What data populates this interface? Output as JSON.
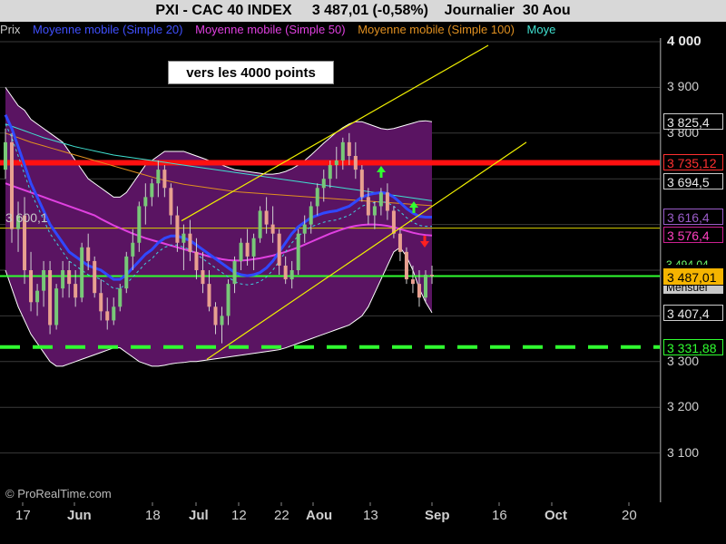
{
  "header": {
    "symbol": "PXI - CAC 40 INDEX",
    "quote": "3 487,01 (-0,58%)",
    "period": "Journalier  30 Aou"
  },
  "legend": [
    {
      "label": "Prix",
      "color": "#c8c8c8"
    },
    {
      "label": "Moyenne mobile (Simple 20)",
      "color": "#3048ff"
    },
    {
      "label": "Moyenne mobile (Simple 50)",
      "color": "#e040e0"
    },
    {
      "label": "Moyenne mobile (Simple 100)",
      "color": "#e09020"
    },
    {
      "label": "Moye",
      "color": "#40e0d0"
    }
  ],
  "annotation": "vers les 4000 points",
  "inline_label": "3 600,1",
  "copyright": "© ProRealTime.com",
  "chart_data": {
    "type": "line",
    "title": "PXI - CAC 40 INDEX",
    "ylim": [
      3020,
      4060
    ],
    "y_ticks": [
      "4 000",
      "3 900",
      "3 800",
      "3 300",
      "3 200",
      "3 100"
    ],
    "x_ticks": [
      {
        "label": "17",
        "bold": false
      },
      {
        "label": "Jun",
        "bold": true
      },
      {
        "label": "18",
        "bold": false
      },
      {
        "label": "Jul",
        "bold": true
      },
      {
        "label": "12",
        "bold": false
      },
      {
        "label": "22",
        "bold": false
      },
      {
        "label": "Aou",
        "bold": true
      },
      {
        "label": "13",
        "bold": false
      },
      {
        "label": "Sep",
        "bold": true
      },
      {
        "label": "16",
        "bold": false
      },
      {
        "label": "Oct",
        "bold": true
      },
      {
        "label": "20",
        "bold": false
      }
    ],
    "price_tags": [
      {
        "value": "3 825,4",
        "bg": "#000000",
        "fg": "#e8e8e8",
        "border": "#cccccc"
      },
      {
        "value": "3 735,12",
        "bg": "#000000",
        "fg": "#ff3030",
        "border": "#ff3030"
      },
      {
        "value": "3 694,5",
        "bg": "#000000",
        "fg": "#e8e8e8",
        "border": "#cccccc"
      },
      {
        "value": "3 616,4",
        "bg": "#000000",
        "fg": "#9a5cc8",
        "border": "#9a5cc8"
      },
      {
        "value": "3 576,4",
        "bg": "#000000",
        "fg": "#ff40c0",
        "border": "#cc2090"
      },
      {
        "value": "3 487,01",
        "bg": "#f5b400",
        "fg": "#000000",
        "border": "#f5b400"
      },
      {
        "value": "3 407,4",
        "bg": "#000000",
        "fg": "#e8e8e8",
        "border": "#cccccc"
      },
      {
        "value": "3 331,88",
        "bg": "#000000",
        "fg": "#30ff30",
        "border": "#30ff30"
      }
    ],
    "hidden_tag_text": "3 494,04",
    "hidden_tag_text2": "Mensuel",
    "levels": [
      {
        "name": "resistance",
        "value": 3735.12,
        "color": "#ff1010",
        "style": "solid"
      },
      {
        "name": "support",
        "value": 3487.01,
        "color": "#30ff30",
        "style": "solid"
      },
      {
        "name": "support-dashed",
        "value": 3331.88,
        "color": "#30ff30",
        "style": "dashed"
      },
      {
        "name": "thin-yellow",
        "value": 3592,
        "color": "#d8d000",
        "style": "thin"
      }
    ],
    "candles": [
      [
        3720,
        3810,
        3700,
        3780
      ],
      [
        3780,
        3800,
        3560,
        3590
      ],
      [
        3590,
        3650,
        3540,
        3620
      ],
      [
        3620,
        3660,
        3470,
        3500
      ],
      [
        3500,
        3540,
        3410,
        3430
      ],
      [
        3430,
        3470,
        3400,
        3455
      ],
      [
        3455,
        3520,
        3420,
        3500
      ],
      [
        3500,
        3520,
        3360,
        3380
      ],
      [
        3380,
        3470,
        3370,
        3460
      ],
      [
        3460,
        3520,
        3440,
        3500
      ],
      [
        3500,
        3520,
        3440,
        3470
      ],
      [
        3470,
        3500,
        3420,
        3440
      ],
      [
        3440,
        3560,
        3430,
        3550
      ],
      [
        3550,
        3580,
        3500,
        3520
      ],
      [
        3520,
        3530,
        3440,
        3450
      ],
      [
        3450,
        3480,
        3390,
        3410
      ],
      [
        3410,
        3440,
        3370,
        3390
      ],
      [
        3390,
        3440,
        3380,
        3420
      ],
      [
        3420,
        3470,
        3410,
        3460
      ],
      [
        3460,
        3540,
        3450,
        3530
      ],
      [
        3530,
        3590,
        3500,
        3560
      ],
      [
        3560,
        3650,
        3540,
        3640
      ],
      [
        3640,
        3690,
        3600,
        3660
      ],
      [
        3660,
        3700,
        3640,
        3690
      ],
      [
        3690,
        3740,
        3660,
        3720
      ],
      [
        3720,
        3730,
        3660,
        3680
      ],
      [
        3680,
        3690,
        3600,
        3620
      ],
      [
        3620,
        3640,
        3540,
        3560
      ],
      [
        3560,
        3600,
        3500,
        3580
      ],
      [
        3580,
        3610,
        3520,
        3540
      ],
      [
        3540,
        3570,
        3480,
        3500
      ],
      [
        3500,
        3540,
        3450,
        3470
      ],
      [
        3470,
        3500,
        3410,
        3420
      ],
      [
        3420,
        3430,
        3360,
        3380
      ],
      [
        3380,
        3420,
        3340,
        3400
      ],
      [
        3400,
        3480,
        3380,
        3470
      ],
      [
        3470,
        3530,
        3450,
        3520
      ],
      [
        3520,
        3570,
        3500,
        3560
      ],
      [
        3560,
        3590,
        3510,
        3530
      ],
      [
        3530,
        3580,
        3500,
        3570
      ],
      [
        3570,
        3640,
        3560,
        3630
      ],
      [
        3630,
        3660,
        3580,
        3600
      ],
      [
        3600,
        3640,
        3560,
        3580
      ],
      [
        3580,
        3590,
        3490,
        3510
      ],
      [
        3510,
        3530,
        3470,
        3480
      ],
      [
        3480,
        3520,
        3460,
        3500
      ],
      [
        3500,
        3590,
        3490,
        3580
      ],
      [
        3580,
        3620,
        3560,
        3600
      ],
      [
        3600,
        3650,
        3580,
        3640
      ],
      [
        3640,
        3690,
        3620,
        3680
      ],
      [
        3680,
        3720,
        3650,
        3700
      ],
      [
        3700,
        3740,
        3680,
        3730
      ],
      [
        3730,
        3770,
        3700,
        3740
      ],
      [
        3740,
        3790,
        3720,
        3780
      ],
      [
        3780,
        3800,
        3730,
        3750
      ],
      [
        3750,
        3780,
        3700,
        3720
      ],
      [
        3720,
        3730,
        3650,
        3660
      ],
      [
        3660,
        3680,
        3600,
        3620
      ],
      [
        3620,
        3650,
        3590,
        3640
      ],
      [
        3640,
        3680,
        3620,
        3670
      ],
      [
        3670,
        3690,
        3610,
        3630
      ],
      [
        3630,
        3640,
        3570,
        3580
      ],
      [
        3580,
        3590,
        3520,
        3540
      ],
      [
        3540,
        3550,
        3470,
        3480
      ],
      [
        3480,
        3510,
        3450,
        3470
      ],
      [
        3470,
        3500,
        3420,
        3440
      ],
      [
        3440,
        3500,
        3430,
        3490
      ],
      [
        3490,
        3510,
        3470,
        3487
      ]
    ],
    "ma20": [
      3840,
      3810,
      3770,
      3730,
      3690,
      3660,
      3630,
      3600,
      3580,
      3560,
      3540,
      3530,
      3520,
      3510,
      3505,
      3500,
      3490,
      3480,
      3480,
      3490,
      3505,
      3520,
      3535,
      3545,
      3560,
      3570,
      3575,
      3575,
      3570,
      3565,
      3555,
      3545,
      3535,
      3525,
      3515,
      3505,
      3495,
      3490,
      3488,
      3490,
      3495,
      3505,
      3520,
      3540,
      3560,
      3580,
      3595,
      3605,
      3615,
      3620,
      3625,
      3628,
      3630,
      3635,
      3640,
      3650,
      3660,
      3665,
      3668,
      3670,
      3668,
      3660,
      3648,
      3635,
      3625,
      3618,
      3616,
      3616
    ],
    "ma50": [
      3690,
      3685,
      3680,
      3675,
      3670,
      3665,
      3660,
      3655,
      3650,
      3645,
      3640,
      3635,
      3630,
      3625,
      3620,
      3612,
      3605,
      3598,
      3592,
      3586,
      3580,
      3575,
      3570,
      3566,
      3562,
      3558,
      3554,
      3550,
      3546,
      3542,
      3538,
      3534,
      3530,
      3527,
      3524,
      3522,
      3521,
      3521,
      3522,
      3524,
      3526,
      3529,
      3532,
      3536,
      3540,
      3545,
      3550,
      3556,
      3562,
      3568,
      3574,
      3580,
      3585,
      3590,
      3594,
      3597,
      3599,
      3600,
      3600,
      3599,
      3597,
      3594,
      3590,
      3586,
      3582,
      3579,
      3577,
      3576
    ],
    "ma100": [
      3800,
      3795,
      3790,
      3785,
      3780,
      3776,
      3772,
      3768,
      3764,
      3760,
      3756,
      3752,
      3748,
      3744,
      3740,
      3736,
      3732,
      3728,
      3724,
      3720,
      3716,
      3712,
      3708,
      3704,
      3700,
      3697,
      3694,
      3691,
      3688,
      3686,
      3684,
      3682,
      3680,
      3678,
      3676,
      3674,
      3672,
      3671,
      3670,
      3669,
      3668,
      3667,
      3666,
      3665,
      3664,
      3663,
      3662,
      3661,
      3660,
      3659,
      3658,
      3657,
      3656,
      3655,
      3654,
      3653,
      3652,
      3651,
      3650,
      3649,
      3648,
      3647,
      3646,
      3645,
      3644,
      3643,
      3642,
      3641
    ],
    "ma200": [
      3820,
      3815,
      3810,
      3805,
      3800,
      3795,
      3790,
      3786,
      3782,
      3778,
      3774,
      3770,
      3767,
      3764,
      3761,
      3758,
      3755,
      3752,
      3750,
      3748,
      3746,
      3744,
      3742,
      3740,
      3738,
      3736,
      3734,
      3732,
      3730,
      3728,
      3726,
      3724,
      3722,
      3720,
      3718,
      3716,
      3714,
      3712,
      3710,
      3708,
      3706,
      3704,
      3702,
      3700,
      3698,
      3696,
      3694,
      3692,
      3690,
      3688,
      3686,
      3684,
      3682,
      3680,
      3678,
      3676,
      3674,
      3672,
      3670,
      3668,
      3666,
      3664,
      3662,
      3660,
      3658,
      3656,
      3654,
      3652
    ],
    "bb_upper": [
      3900,
      3880,
      3860,
      3850,
      3830,
      3820,
      3810,
      3800,
      3790,
      3780,
      3760,
      3740,
      3720,
      3700,
      3690,
      3680,
      3670,
      3660,
      3660,
      3670,
      3690,
      3710,
      3730,
      3740,
      3750,
      3760,
      3760,
      3760,
      3760,
      3755,
      3750,
      3745,
      3740,
      3735,
      3730,
      3725,
      3720,
      3718,
      3716,
      3714,
      3712,
      3710,
      3710,
      3712,
      3716,
      3722,
      3730,
      3740,
      3752,
      3765,
      3778,
      3790,
      3802,
      3812,
      3820,
      3825,
      3825,
      3820,
      3815,
      3810,
      3808,
      3810,
      3814,
      3818,
      3822,
      3826,
      3827,
      3825
    ],
    "bb_lower": [
      3500,
      3460,
      3420,
      3390,
      3360,
      3340,
      3320,
      3300,
      3290,
      3290,
      3295,
      3300,
      3305,
      3310,
      3315,
      3320,
      3325,
      3330,
      3330,
      3320,
      3310,
      3300,
      3295,
      3290,
      3290,
      3292,
      3295,
      3297,
      3298,
      3300,
      3300,
      3302,
      3304,
      3306,
      3308,
      3310,
      3312,
      3314,
      3316,
      3318,
      3320,
      3322,
      3324,
      3326,
      3330,
      3335,
      3340,
      3345,
      3350,
      3355,
      3360,
      3365,
      3370,
      3375,
      3380,
      3390,
      3400,
      3420,
      3450,
      3480,
      3510,
      3540,
      3550,
      3530,
      3500,
      3460,
      3430,
      3407
    ]
  }
}
